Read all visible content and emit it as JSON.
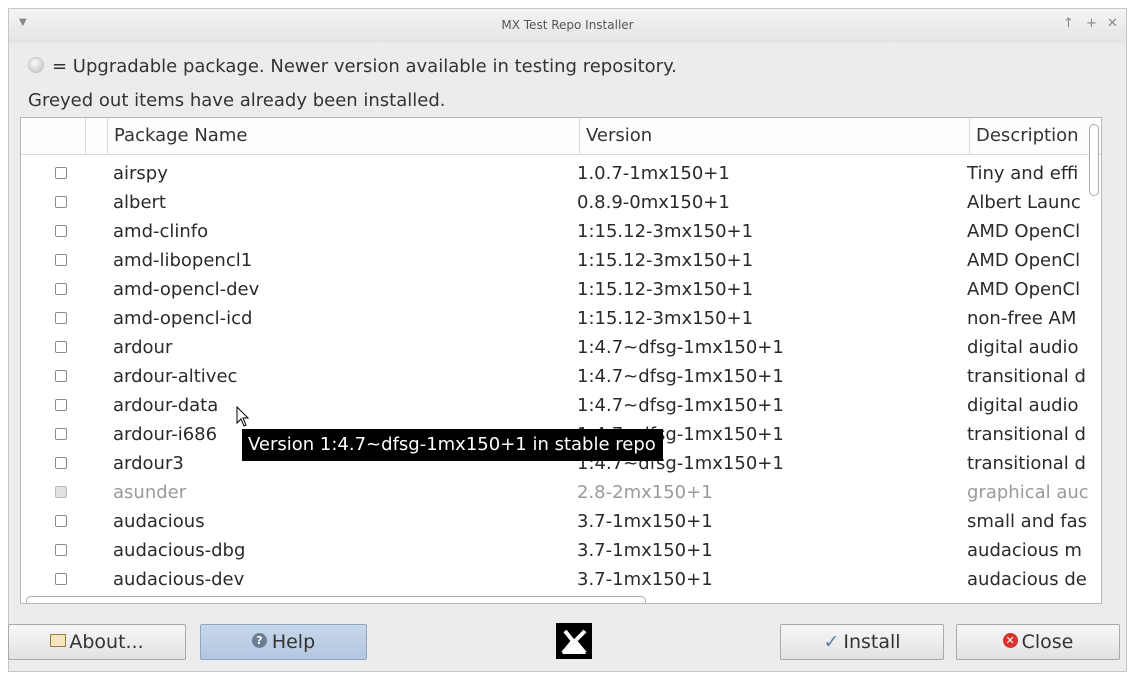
{
  "window": {
    "title": "MX Test Repo Installer"
  },
  "info": {
    "upgradable_text": "= Upgradable package. Newer version available in testing repository.",
    "greyed_text": "Greyed out items have already been installed."
  },
  "table": {
    "headers": {
      "name": "Package Name",
      "version": "Version",
      "description": "Description"
    },
    "rows": [
      {
        "name": "airspy",
        "version": "1.0.7-1mx150+1",
        "description": "Tiny and effi",
        "installed": false
      },
      {
        "name": "albert",
        "version": "0.8.9-0mx150+1",
        "description": "Albert Launc",
        "installed": false
      },
      {
        "name": "amd-clinfo",
        "version": "1:15.12-3mx150+1",
        "description": "AMD OpenCl",
        "installed": false
      },
      {
        "name": "amd-libopencl1",
        "version": "1:15.12-3mx150+1",
        "description": "AMD OpenCl",
        "installed": false
      },
      {
        "name": "amd-opencl-dev",
        "version": "1:15.12-3mx150+1",
        "description": "AMD OpenCl",
        "installed": false
      },
      {
        "name": "amd-opencl-icd",
        "version": "1:15.12-3mx150+1",
        "description": "non-free AM",
        "installed": false
      },
      {
        "name": "ardour",
        "version": "1:4.7~dfsg-1mx150+1",
        "description": "digital audio",
        "installed": false
      },
      {
        "name": "ardour-altivec",
        "version": "1:4.7~dfsg-1mx150+1",
        "description": "transitional d",
        "installed": false
      },
      {
        "name": "ardour-data",
        "version": "1:4.7~dfsg-1mx150+1",
        "description": "digital audio",
        "installed": false
      },
      {
        "name": "ardour-i686",
        "version": "1:4.7~dfsg-1mx150+1",
        "description": "transitional d",
        "installed": false
      },
      {
        "name": "ardour3",
        "version": "1:4.7~dfsg-1mx150+1",
        "description": "transitional d",
        "installed": false
      },
      {
        "name": "asunder",
        "version": "2.8-2mx150+1",
        "description": "graphical auc",
        "installed": true
      },
      {
        "name": "audacious",
        "version": "3.7-1mx150+1",
        "description": "small and fas",
        "installed": false
      },
      {
        "name": "audacious-dbg",
        "version": "3.7-1mx150+1",
        "description": "audacious m",
        "installed": false
      },
      {
        "name": "audacious-dev",
        "version": "3.7-1mx150+1",
        "description": "audacious de",
        "installed": false
      }
    ]
  },
  "tooltip": {
    "text": "Version 1:4.7~dfsg-1mx150+1 in stable repo"
  },
  "buttons": {
    "about": "About...",
    "help": "Help",
    "install": "Install",
    "close": "Close"
  },
  "icons": {
    "upgradable": "upgradable-icon",
    "about": "about-icon",
    "help": "help-icon",
    "install": "checkmark-icon",
    "close": "close-icon",
    "logo": "mx-logo-icon"
  },
  "colors": {
    "help_button": "#b8cbe3",
    "close_icon": "#d9322b",
    "greyed_text": "#9a9a9a"
  }
}
